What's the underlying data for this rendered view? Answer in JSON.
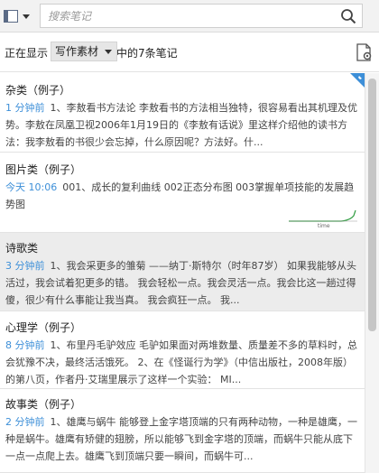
{
  "search": {
    "placeholder": "搜索笔记"
  },
  "filter": {
    "prefix": "正在显示",
    "notebook": "写作素材",
    "suffix": "中的7条笔记"
  },
  "notes": [
    {
      "title": "杂类（例子）",
      "time": "1 分钟前",
      "snippet": "1、李敖看书方法论 李敖看书的方法相当独特，很容易看出其机理及优势。李敖在凤凰卫视2006年1月19日的《李敖有话说》里这样介绍他的读书方法：我李敖看的书很少会忘掉，什么原因呢？方法好。什..."
    },
    {
      "title": "图片类（例子）",
      "time": "今天 10:06",
      "snippet": "001、成长的复利曲线 002正态分布图 003掌握单项技能的发展趋势图",
      "thumb_label": "time"
    },
    {
      "title": "诗歌类",
      "time": "3 分钟前",
      "snippet": "1、我会采更多的雏菊 ——纳丁·斯特尔（时年87岁） 如果我能够从头活过，我会试着犯更多的错。 我会轻松一点。我会灵活一点。我会比这一趟过得傻，很少有什么事能让我当真。 我会疯狂一点。 我..."
    },
    {
      "title": "心理学（例子）",
      "time": "8 分钟前",
      "snippet": "1、布里丹毛驴效应 毛驴如果面对两堆数量、质量差不多的草料时，总会犹豫不决，最终活活饿死。 2、在《怪诞行为学》（中信出版社，2008年版）的第八页，作者丹·艾瑞里展示了这样一个实验： MI..."
    },
    {
      "title": "故事类（例子）",
      "time": "2 分钟前",
      "snippet": "1、雄鹰与蜗牛 能够登上金字塔顶端的只有两种动物，一种是雄鹰，一种是蜗牛。雄鹰有矫健的翅膀，所以能够飞到金字塔的顶端，而蜗牛只能从底下一点一点爬上去。雄鹰飞到顶端只要一瞬间，而蜗牛可..."
    }
  ]
}
